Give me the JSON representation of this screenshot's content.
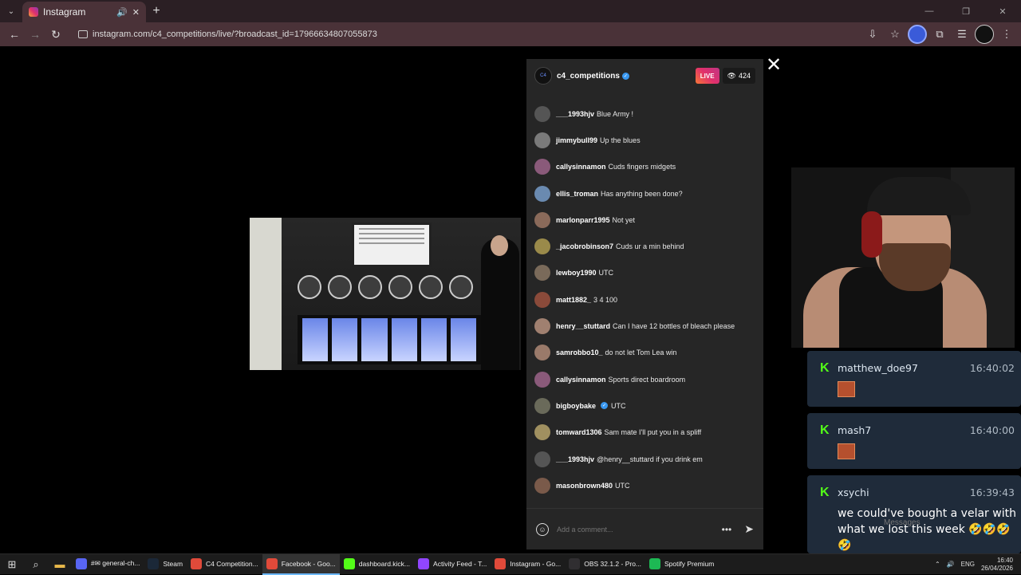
{
  "browser": {
    "tab_title": "Instagram",
    "url": "instagram.com/c4_competitions/live/?broadcast_id=17966634807055873",
    "new_tab": "+",
    "tab_menu": "⌄",
    "win_minimize": "—",
    "win_restore": "❐",
    "win_close": "✕"
  },
  "live": {
    "handle": "c4_competitions",
    "logo_text": "C4",
    "live_label": "LIVE",
    "viewer_count": "424",
    "comment_placeholder": "Add a comment...",
    "comments": [
      {
        "user": "___1993hjv",
        "text": "Blue Army !",
        "color": "#555"
      },
      {
        "user": "jimmybull99",
        "text": "Up the blues",
        "color": "#7a7a7a"
      },
      {
        "user": "callysinnamon",
        "text": "Cuds fingers midgets",
        "color": "#8a5a7a"
      },
      {
        "user": "ellis_troman",
        "text": "Has anything been done?",
        "color": "#6a8ab0"
      },
      {
        "user": "marlonparr1995",
        "text": "Not yet",
        "color": "#8a6a5a"
      },
      {
        "user": "_jacobrobinson7",
        "text": "Cuds ur a min behind",
        "color": "#9a8a4a"
      },
      {
        "user": "lewboy1990",
        "text": "UTC",
        "color": "#7a6a5a"
      },
      {
        "user": "matt1882_",
        "text": "3 4 100",
        "color": "#8a4a3a"
      },
      {
        "user": "henry__stuttard",
        "text": "Can I have 12 bottles of bleach please",
        "color": "#a08070"
      },
      {
        "user": "samrobbo10_",
        "text": "do not let Tom Lea win",
        "color": "#9a7a6a"
      },
      {
        "user": "callysinnamon",
        "text": "Sports direct boardroom",
        "color": "#8a5a7a"
      },
      {
        "user": "bigboybake",
        "text": "UTC",
        "color": "#6a6a5a",
        "verified": true
      },
      {
        "user": "tomward1306",
        "text": "Sam mate I'll put you in a spliff",
        "color": "#a09060"
      },
      {
        "user": "___1993hjv",
        "text": "@henry__stuttard if you drink em",
        "color": "#555"
      },
      {
        "user": "masonbrown480",
        "text": "UTC",
        "color": "#7a5a4a"
      }
    ]
  },
  "kick_chat": {
    "messages": [
      {
        "user": "matthew_doe97",
        "time": "16:40:02",
        "emote": true
      },
      {
        "user": "mash7",
        "time": "16:40:00",
        "emote": true
      },
      {
        "user": "xsychi",
        "time": "16:39:43",
        "text": "we could've bought a velar with what we lost this week 🤣🤣🤣🤣"
      }
    ],
    "messages_ghost": "Messages"
  },
  "taskbar": {
    "apps": [
      {
        "label": "#✉ general-ch...",
        "color": "#5865f2"
      },
      {
        "label": "Steam",
        "color": "#1b2838"
      },
      {
        "label": "C4 Competition...",
        "color": "#e04a3a"
      },
      {
        "label": "Facebook - Goo...",
        "color": "#e04a3a",
        "active": true
      },
      {
        "label": "dashboard.kick...",
        "color": "#53fc18"
      },
      {
        "label": "Activity Feed - T...",
        "color": "#9146ff"
      },
      {
        "label": "Instagram - Go...",
        "color": "#e04a3a"
      },
      {
        "label": "OBS 32.1.2 - Pro...",
        "color": "#302e31"
      },
      {
        "label": "Spotify Premium",
        "color": "#1db954"
      }
    ],
    "language": "ENG",
    "time": "16:40",
    "date": "26/04/2026"
  }
}
